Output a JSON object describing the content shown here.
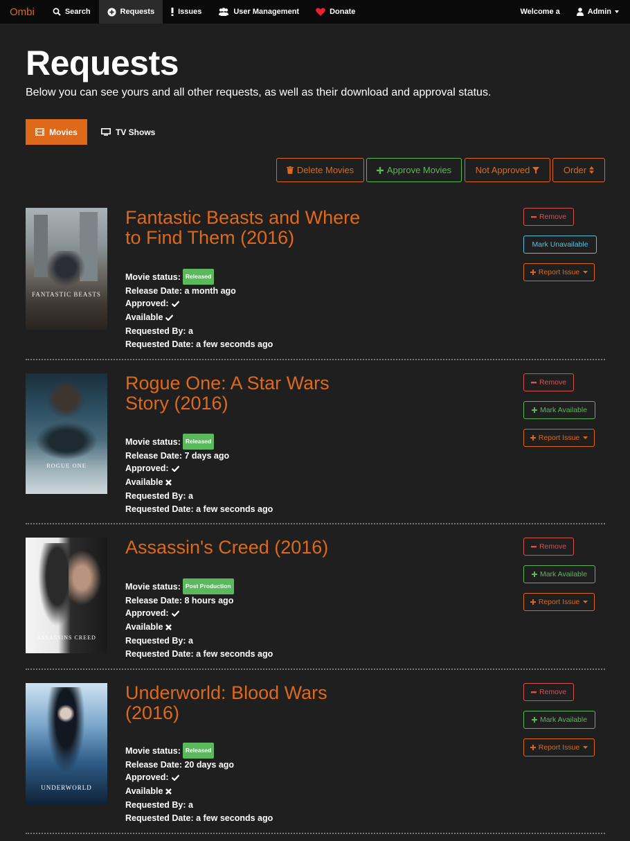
{
  "nav": {
    "brand": "Ombi",
    "items": [
      {
        "label": "Search"
      },
      {
        "label": "Requests"
      },
      {
        "label": "Issues"
      },
      {
        "label": "User Management"
      },
      {
        "label": "Donate"
      }
    ],
    "welcome": "Welcome a",
    "user": "Admin"
  },
  "header": {
    "title": "Requests",
    "description": "Below you can see yours and all other requests, as well as their download and approval status."
  },
  "tabs": [
    {
      "label": "Movies",
      "active": true
    },
    {
      "label": "TV Shows",
      "active": false
    }
  ],
  "toolbar": {
    "delete": "Delete Movies",
    "approve": "Approve Movies",
    "filter": "Not Approved",
    "order": "Order"
  },
  "labels": {
    "movie_status": "Movie status:",
    "release_date": "Release Date:",
    "approved": "Approved:",
    "available": "Available",
    "requested_by": "Requested By:",
    "requested_date": "Requested Date:",
    "remove": "Remove",
    "mark_available": "Mark Available",
    "mark_unavailable": "Mark Unavailable",
    "report_issue": "Report Issue"
  },
  "requests": [
    {
      "title": "Fantastic Beasts and Where to Find Them (2016)",
      "status": "Released",
      "release_date": "a month ago",
      "approved": true,
      "available": true,
      "requested_by": "a",
      "requested_date": "a few seconds ago",
      "poster_text": "FANTASTIC BEASTS"
    },
    {
      "title": "Rogue One: A Star Wars Story (2016)",
      "status": "Released",
      "release_date": "7 days ago",
      "approved": true,
      "available": false,
      "requested_by": "a",
      "requested_date": "a few seconds ago",
      "poster_text": "ROGUE ONE"
    },
    {
      "title": "Assassin's Creed (2016)",
      "status": "Post Production",
      "release_date": "8 hours ago",
      "approved": true,
      "available": false,
      "requested_by": "a",
      "requested_date": "a few seconds ago",
      "poster_text": "ASSASSINS CREED"
    },
    {
      "title": "Underworld: Blood Wars (2016)",
      "status": "Released",
      "release_date": "20 days ago",
      "approved": true,
      "available": false,
      "requested_by": "a",
      "requested_date": "a few seconds ago",
      "poster_text": "UNDERWORLD"
    }
  ],
  "colors": {
    "accent": "#df691a",
    "success": "#5cb85c",
    "danger": "#d9534f",
    "info": "#5bc0de",
    "background": "#1f1f1f",
    "navbar": "#0a0a0a"
  },
  "icons": {
    "search": "search-icon",
    "requests": "plus-circle-icon",
    "issues": "exclamation-icon",
    "users": "users-icon",
    "donate": "heart-icon",
    "user": "user-icon",
    "movies": "film-icon",
    "tv": "monitor-icon",
    "delete": "trash-icon",
    "approve": "plus-icon",
    "filter": "filter-icon",
    "order": "sort-icon",
    "remove": "minus-icon",
    "mark": "plus-icon",
    "report": "plus-icon",
    "approved": "check-icon",
    "unavailable": "x-icon"
  }
}
